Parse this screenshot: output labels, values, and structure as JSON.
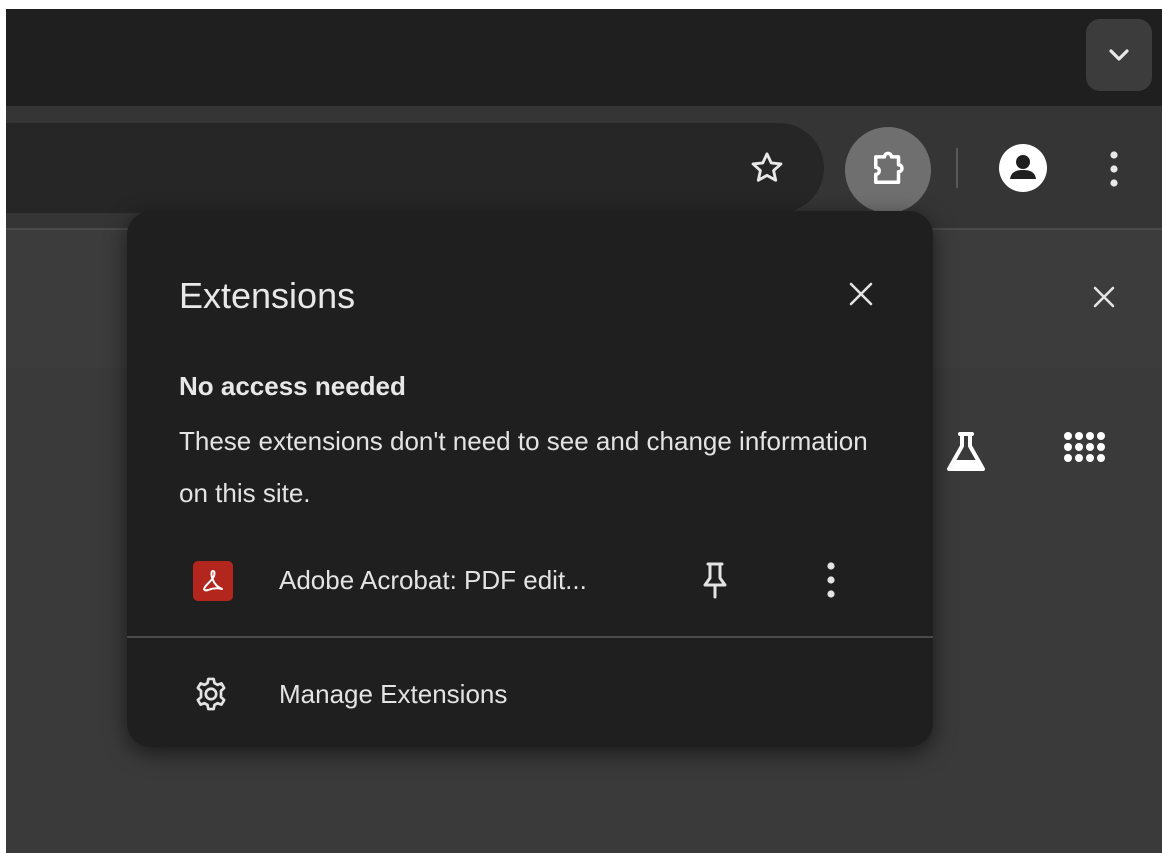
{
  "colors": {
    "frame_bg": "#3a3a3a",
    "tabstrip_bg": "#1f1f1f",
    "toolbar_bg": "#353535",
    "popup_bg": "#1f1f1f",
    "text": "#e3e3e3",
    "acrobat_red": "#b3261e",
    "extensions_button_active": "#6f6f6f"
  },
  "tabstrip": {
    "dropdown_icon": "chevron-down-icon"
  },
  "toolbar": {
    "bookmark_icon": "star-outline-icon",
    "extensions_icon": "puzzle-piece-icon",
    "profile_icon": "account-circle-icon",
    "menu_icon": "more-vertical-icon"
  },
  "infobar": {
    "close_icon": "close-icon"
  },
  "content": {
    "labs_icon": "flask-icon",
    "apps_icon": "apps-grid-icon"
  },
  "popup": {
    "title": "Extensions",
    "close_icon": "close-icon",
    "section_heading": "No access needed",
    "section_description": "These extensions don't need to see and change information on this site.",
    "extensions": [
      {
        "name": "Adobe Acrobat: PDF edit...",
        "icon": "adobe-acrobat-icon",
        "pin_icon": "pin-icon",
        "more_icon": "more-vertical-icon"
      }
    ],
    "manage_label": "Manage Extensions",
    "manage_icon": "gear-icon"
  }
}
